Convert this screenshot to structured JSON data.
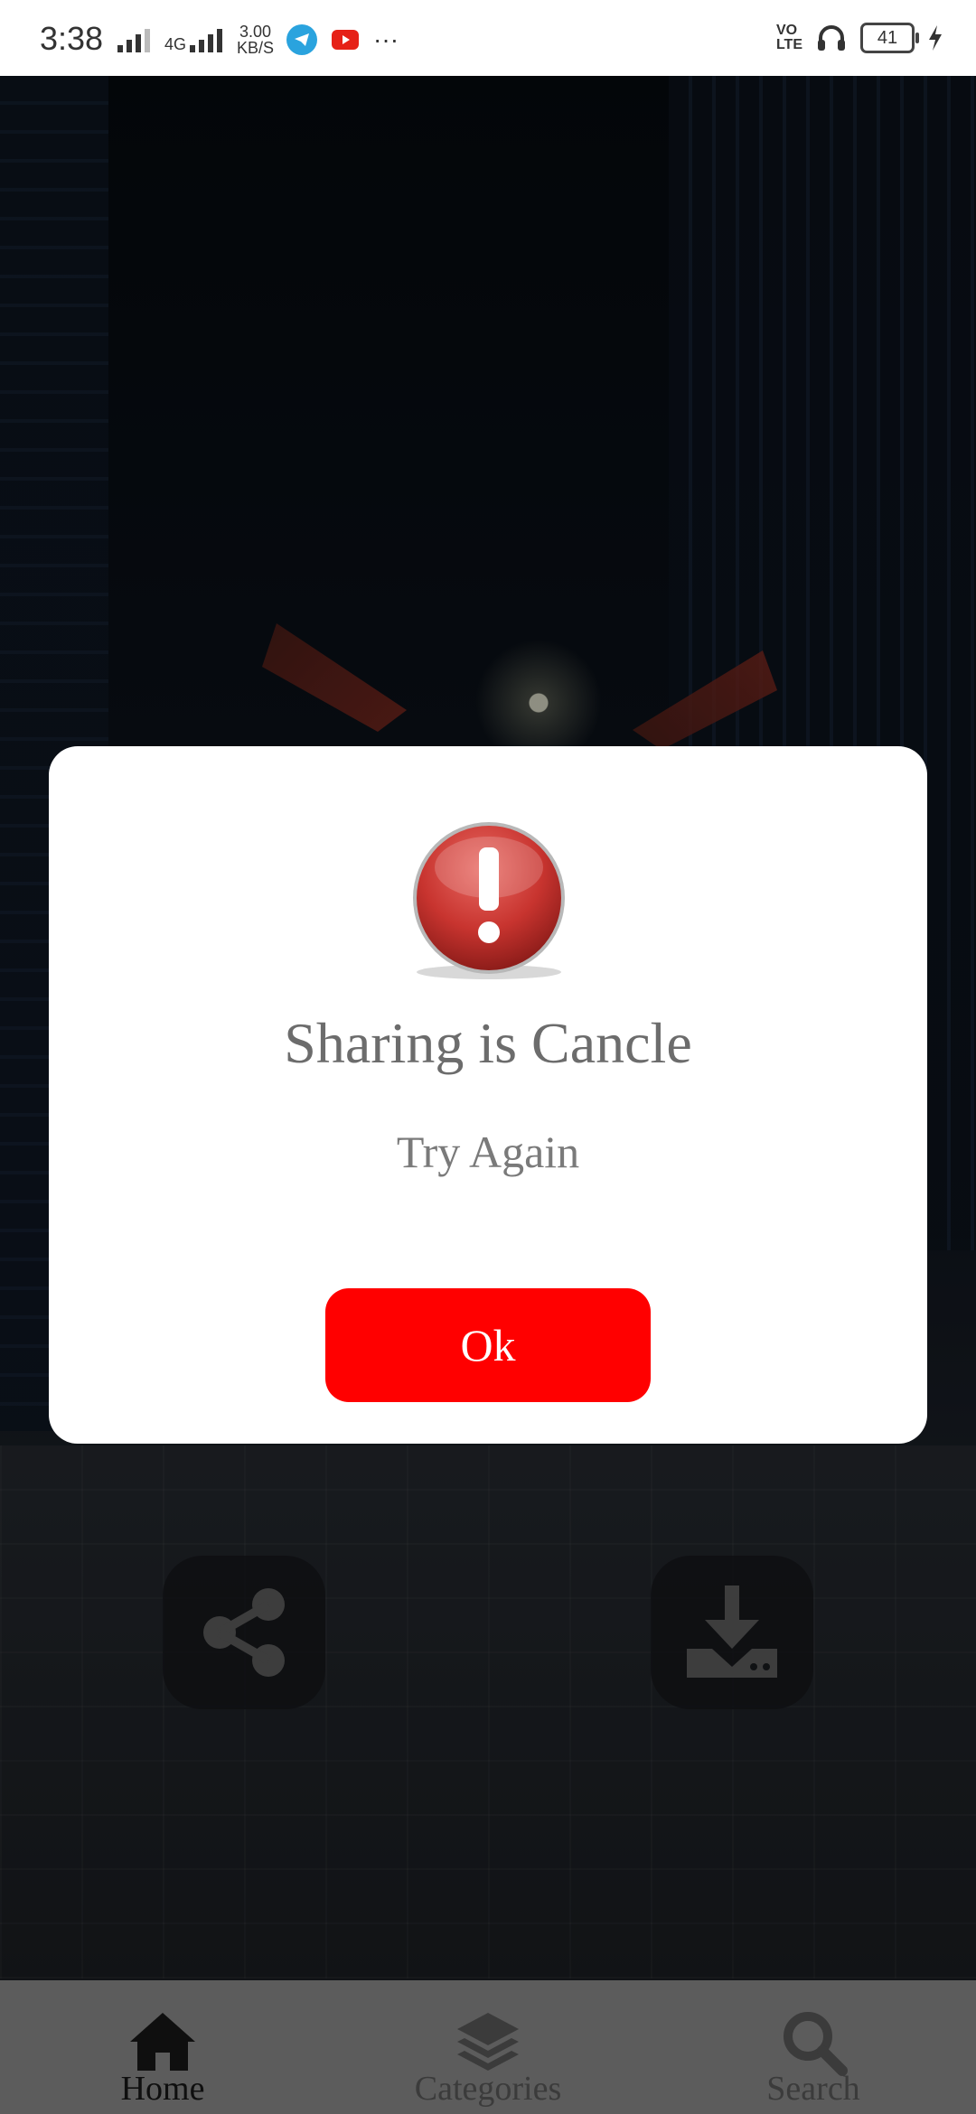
{
  "status_bar": {
    "time": "3:38",
    "network_type": "4G",
    "speed_value": "3.00",
    "speed_unit": "KB/S",
    "more_indicator": "···",
    "volte_top": "VO",
    "volte_bottom": "LTE",
    "battery_level": "41"
  },
  "dialog": {
    "title": "Sharing is Cancle",
    "message": "Try Again",
    "ok_label": "Ok",
    "icon": "exclamation-alert-icon"
  },
  "actions": {
    "share_icon": "share-icon",
    "download_icon": "download-icon"
  },
  "bottom_nav": {
    "items": [
      {
        "label": "Home",
        "icon": "home-icon",
        "active": true
      },
      {
        "label": "Categories",
        "icon": "layers-icon",
        "active": false
      },
      {
        "label": "Search",
        "icon": "search-icon",
        "active": false
      }
    ]
  },
  "colors": {
    "accent": "#ff0000",
    "nav_bg": "#5c5c5c",
    "dialog_bg": "#ffffff",
    "alert_red": "#c8342f"
  }
}
